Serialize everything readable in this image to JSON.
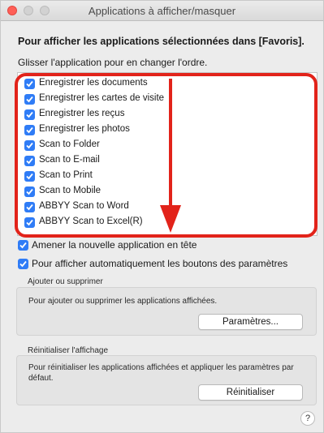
{
  "window": {
    "title": "Applications à afficher/masquer"
  },
  "heading": "Pour afficher les applications sélectionnées dans [Favoris].",
  "instruction": "Glisser l'application pour en changer l'ordre.",
  "apps": [
    {
      "label": "Enregistrer les documents",
      "checked": true
    },
    {
      "label": "Enregistrer les cartes de visite",
      "checked": true
    },
    {
      "label": "Enregistrer les reçus",
      "checked": true
    },
    {
      "label": "Enregistrer les photos",
      "checked": true
    },
    {
      "label": "Scan to Folder",
      "checked": true
    },
    {
      "label": "Scan to E-mail",
      "checked": true
    },
    {
      "label": "Scan to Print",
      "checked": true
    },
    {
      "label": "Scan to Mobile",
      "checked": true
    },
    {
      "label": "ABBYY Scan to Word",
      "checked": true
    },
    {
      "label": "ABBYY Scan to Excel(R)",
      "checked": true
    }
  ],
  "options": {
    "new_app_first": "Amener la nouvelle application en tête",
    "auto_show_params": "Pour afficher automatiquement les boutons des paramètres"
  },
  "add_remove": {
    "title": "Ajouter ou supprimer",
    "description": "Pour ajouter ou supprimer les applications affichées.",
    "button": "Paramètres..."
  },
  "reset": {
    "title": "Réinitialiser l'affichage",
    "description": "Pour réinitialiser les applications affichées et appliquer les paramètres par défaut.",
    "button": "Réinitialiser"
  },
  "help": "?",
  "colors": {
    "accent": "#2f7cf6",
    "annotation": "#e2231a"
  }
}
